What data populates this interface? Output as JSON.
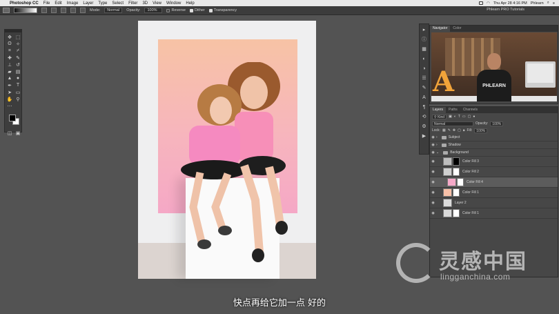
{
  "menubar": {
    "app": "Photoshop CC",
    "items": [
      "File",
      "Edit",
      "Image",
      "Layer",
      "Type",
      "Select",
      "Filter",
      "3D",
      "View",
      "Window",
      "Help"
    ],
    "clock": "Thu Apr 28  4:16 PM",
    "user": "Phlearn"
  },
  "options": {
    "mode_label": "Mode:",
    "mode_value": "Normal",
    "opacity_label": "Opacity:",
    "opacity_value": "100%",
    "reverse": "Reverse",
    "dither": "Dither",
    "transparency": "Transparency",
    "doc_title": "Phlearn PRO Tutorials"
  },
  "navigator": {
    "tabs": [
      "Navigator",
      "Color"
    ],
    "shirt_text": "PHLEARN"
  },
  "layers_panel": {
    "tabs": [
      "Layers",
      "Paths",
      "Channels"
    ],
    "filter_label": "Kind",
    "blend_mode": "Normal",
    "opacity_label": "Opacity:",
    "opacity_value": "100%",
    "lock_label": "Lock:",
    "fill_label": "Fill:",
    "fill_value": "100%",
    "layers": [
      {
        "name": "Subject",
        "kind": "group"
      },
      {
        "name": "Shadow",
        "kind": "group"
      },
      {
        "name": "Background",
        "kind": "group"
      },
      {
        "name": "Color Fill 3",
        "kind": "fill",
        "thumb": "#bdbdbd"
      },
      {
        "name": "Color Fill 2",
        "kind": "fill",
        "thumb": "#cfcfcf"
      },
      {
        "name": "Color Fill 4",
        "kind": "fill",
        "thumb": "#f5a9c8",
        "selected": true
      },
      {
        "name": "Color Fill 1",
        "kind": "fill",
        "thumb": "#f7c0a8"
      },
      {
        "name": "Layer 2",
        "kind": "pixel",
        "thumb": "#dcdcdc"
      },
      {
        "name": "Color Fill 1",
        "kind": "fill",
        "thumb": "#d9d9d9"
      }
    ]
  },
  "subtitle": "快点再给它加一点 好的",
  "watermark": {
    "cn": "灵感中国",
    "url": "lingganchina.com"
  },
  "colors": {
    "accent_pink": "#f5a8c6",
    "accent_peach": "#f7c3a5",
    "panel_bg": "#474747"
  }
}
